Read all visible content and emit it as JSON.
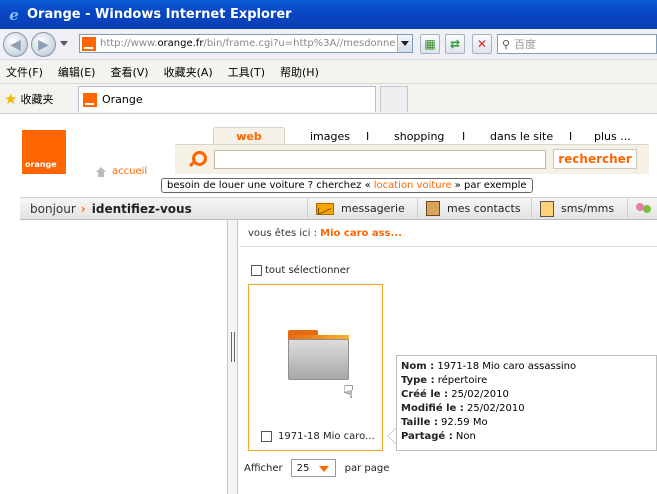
{
  "window": {
    "title": "Orange - Windows Internet Explorer"
  },
  "address": {
    "url_prefix": "http://www.",
    "url_host": "orange.fr",
    "url_rest": "/bin/frame.cgi?u=http%3A//mesdonne",
    "search_placeholder": "百度"
  },
  "menu": [
    "文件(F)",
    "编辑(E)",
    "查看(V)",
    "收藏夹(A)",
    "工具(T)",
    "帮助(H)"
  ],
  "favorites": {
    "label": "收藏夹",
    "tab_title": "Orange"
  },
  "site": {
    "logo_text": "orange",
    "accueil": "accueil",
    "tabs": {
      "web": "web",
      "images": "images",
      "shopping": "shopping",
      "dans_le_site": "dans le site",
      "plus": "plus ...",
      "separator": "I"
    },
    "search_button": "rechercher",
    "hint_before": "besoin de louer une voiture ? cherchez «",
    "hint_link": "location voiture",
    "hint_after": "» par exemple",
    "bonjour": "bonjour",
    "identify": "identifiez-vous",
    "bar_items": {
      "messagerie": "messagerie",
      "contacts": "mes contacts",
      "sms": "sms/mms"
    }
  },
  "content": {
    "breadcrumb_prefix": "vous êtes ici :",
    "breadcrumb_current": "Mio caro ass...",
    "select_all": "tout sélectionner",
    "folder_caption": "1971-18 Mio caro...",
    "info": {
      "nom_label": "Nom :",
      "nom": "1971-18 Mio caro assassino",
      "type_label": "Type :",
      "type": "répertoire",
      "cree_label": "Créé le :",
      "cree": "25/02/2010",
      "modifie_label": "Modifié le :",
      "modifie": "25/02/2010",
      "taille_label": "Taille :",
      "taille": "92.59 Mo",
      "partage_label": "Partagé :",
      "partage": "Non"
    },
    "pager": {
      "label": "Afficher",
      "value": "25",
      "suffix": "par page"
    }
  },
  "colors": {
    "brand": "#ff6600",
    "titlebar": "#0846c4"
  }
}
